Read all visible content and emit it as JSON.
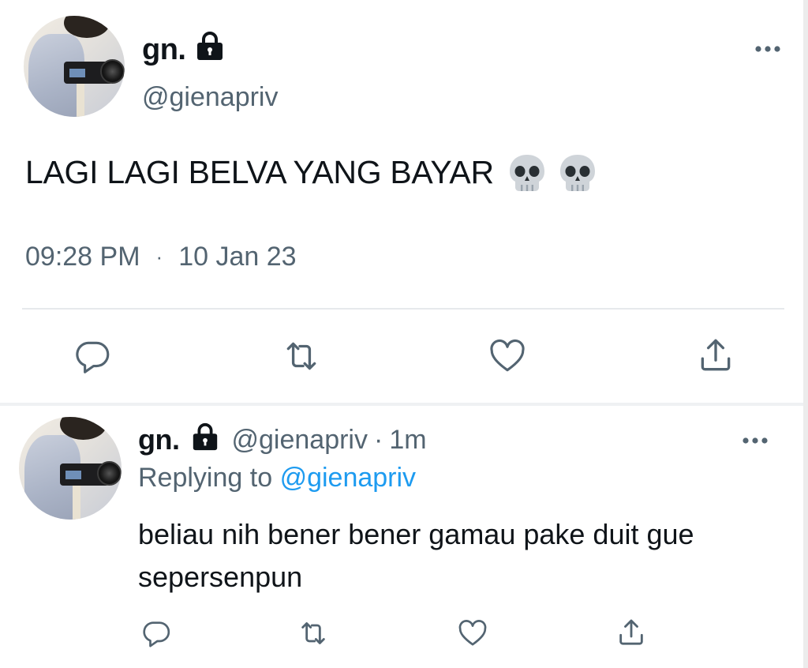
{
  "main_tweet": {
    "display_name": "gn.",
    "handle": "@gienapriv",
    "text": "LAGI LAGI BELVA YANG BAYAR",
    "emoji": [
      "💀",
      "💀"
    ],
    "time": "09:28 PM",
    "separator": "·",
    "date": "10 Jan 23",
    "actions": [
      "reply-icon",
      "retweet-icon",
      "like-icon",
      "share-icon"
    ]
  },
  "reply_tweet": {
    "display_name": "gn.",
    "handle": "@gienapriv",
    "separator": "·",
    "time_ago": "1m",
    "replying_prefix": "Replying to",
    "replying_to": "@gienapriv",
    "text": "beliau nih bener bener gamau pake duit gue sepersenpun",
    "actions": [
      "reply-icon",
      "retweet-icon",
      "like-icon",
      "share-icon"
    ]
  },
  "colors": {
    "text_primary": "#0f1419",
    "text_secondary": "#536471",
    "mention": "#1d9bf0",
    "divider": "#e6e9ec"
  }
}
